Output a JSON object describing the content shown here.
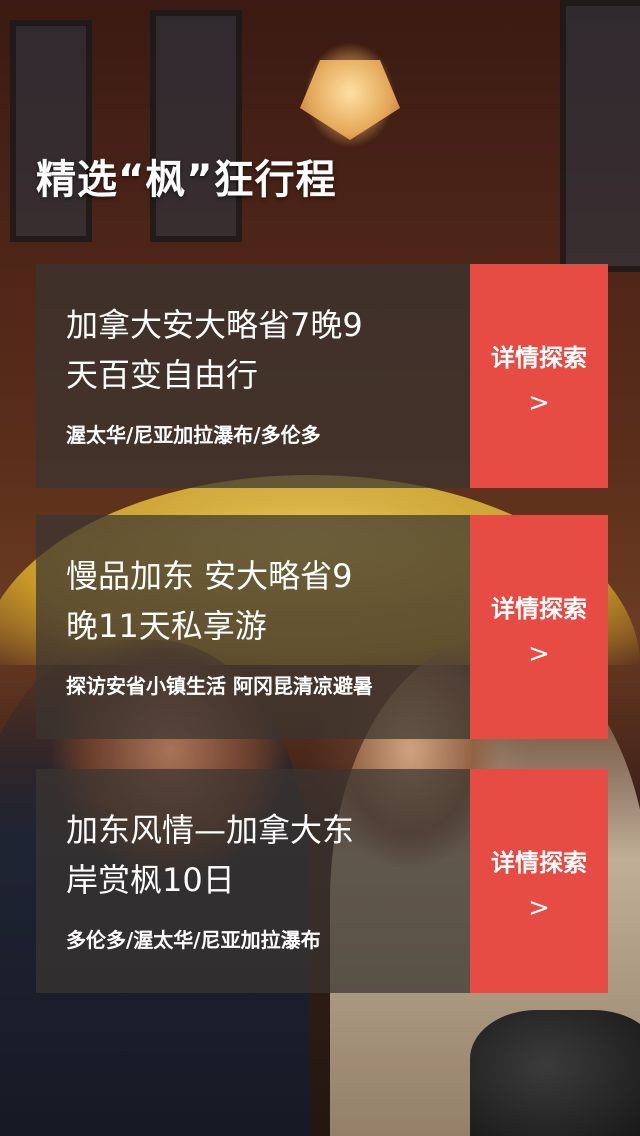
{
  "header": {
    "title": "精选“枫”狂行程"
  },
  "trips": [
    {
      "title_line1": "加拿大安大略省7晚9",
      "title_line2": "天百变自由行",
      "subtitle": "渥太华/尼亚加拉瀑布/多伦多",
      "button_label": "详情探索",
      "button_arrow": ">"
    },
    {
      "title_line1": "慢品加东  安大略省9",
      "title_line2": "晚11天私享游",
      "subtitle": "探访安省小镇生活 阿冈昆清凉避暑",
      "button_label": "详情探索",
      "button_arrow": ">"
    },
    {
      "title_line1": "加东风情—加拿大东",
      "title_line2": "岸赏枫10日",
      "subtitle": "多伦多/渥太华/尼亚加拉瀑布",
      "button_label": "详情探索",
      "button_arrow": ">"
    }
  ],
  "colors": {
    "accent": "#e64c44",
    "card_background": "#3a3430"
  }
}
